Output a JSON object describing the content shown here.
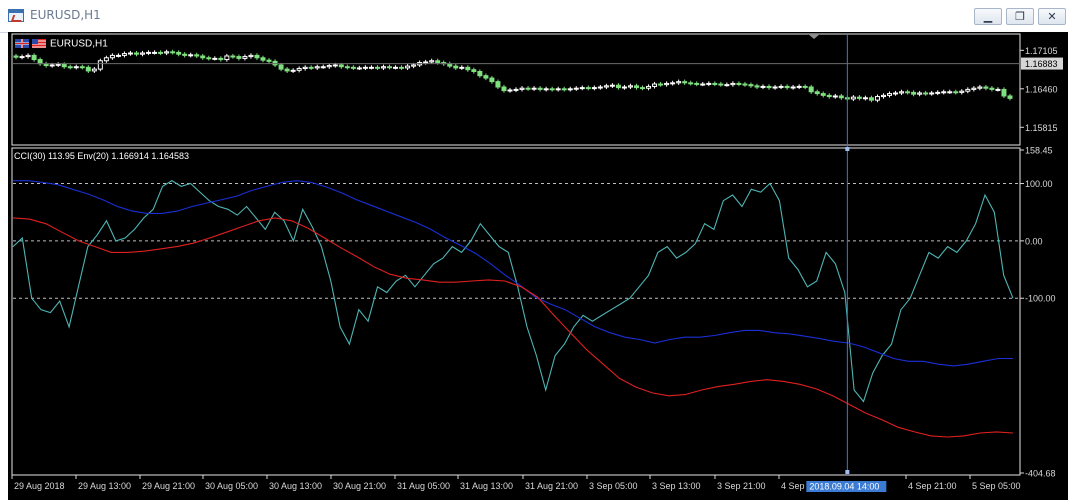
{
  "window": {
    "title": "EURUSD,H1",
    "minimize_label": "▁",
    "restore_label": "❐",
    "close_label": "✕"
  },
  "colors": {
    "background": "#000000",
    "candle_up": "#ffffff",
    "candle_down": "#7fe07f",
    "cci_line": "#4fb4b4",
    "env_upper": "#1a2fd6",
    "env_lower": "#e02020",
    "crosshair": "#3b7bd4",
    "axis_text": "#d8d8d8"
  },
  "chart_data": [
    {
      "type": "candlestick",
      "title": "EURUSD,H1",
      "symbol_flags": [
        "GB-flag-icon",
        "US-flag-icon"
      ],
      "ylim": [
        1.15535,
        1.17345
      ],
      "y_ticks": [
        "1.17105",
        "1.16460",
        "1.15815"
      ],
      "current_price_label": "1.16883",
      "current_price": 1.16883,
      "crosshair_x_index": 138,
      "close": [
        1.1699,
        1.17,
        1.1702,
        1.1695,
        1.1688,
        1.1685,
        1.1686,
        1.1687,
        1.1683,
        1.1682,
        1.1683,
        1.1682,
        1.1676,
        1.1679,
        1.1693,
        1.1698,
        1.1702,
        1.1702,
        1.1705,
        1.1706,
        1.1704,
        1.1706,
        1.1707,
        1.1707,
        1.1706,
        1.1708,
        1.1707,
        1.1704,
        1.1702,
        1.1703,
        1.1701,
        1.1698,
        1.1697,
        1.1697,
        1.1695,
        1.1701,
        1.17,
        1.1697,
        1.17,
        1.1702,
        1.1698,
        1.1694,
        1.1692,
        1.1686,
        1.1679,
        1.1676,
        1.1677,
        1.168,
        1.1682,
        1.1681,
        1.1683,
        1.1683,
        1.1685,
        1.1686,
        1.1683,
        1.1682,
        1.1681,
        1.1681,
        1.1682,
        1.1682,
        1.1681,
        1.1683,
        1.1682,
        1.1682,
        1.1681,
        1.1684,
        1.1686,
        1.169,
        1.1691,
        1.1693,
        1.169,
        1.1688,
        1.1684,
        1.1681,
        1.1682,
        1.1678,
        1.1675,
        1.1668,
        1.1664,
        1.1658,
        1.1649,
        1.1643,
        1.1644,
        1.1645,
        1.1647,
        1.1646,
        1.1647,
        1.1645,
        1.1646,
        1.1645,
        1.1646,
        1.1645,
        1.1646,
        1.1647,
        1.1648,
        1.1647,
        1.1648,
        1.1649,
        1.1651,
        1.1652,
        1.1648,
        1.1649,
        1.1651,
        1.1648,
        1.1647,
        1.165,
        1.1654,
        1.1653,
        1.1655,
        1.1656,
        1.1658,
        1.1656,
        1.1655,
        1.1654,
        1.1654,
        1.1655,
        1.1654,
        1.1653,
        1.1653,
        1.1655,
        1.1654,
        1.1653,
        1.1651,
        1.1649,
        1.165,
        1.1648,
        1.1649,
        1.165,
        1.1648,
        1.1649,
        1.165,
        1.1649,
        1.1641,
        1.1638,
        1.1635,
        1.1633,
        1.1634,
        1.1631,
        1.1629,
        1.1632,
        1.163,
        1.1631,
        1.1627,
        1.1633,
        1.1635,
        1.1638,
        1.1639,
        1.1641,
        1.164,
        1.1637,
        1.1639,
        1.1638,
        1.1639,
        1.164,
        1.1641,
        1.1641,
        1.164,
        1.1642,
        1.1645,
        1.1647,
        1.1649,
        1.1647,
        1.1645,
        1.1645,
        1.1634,
        1.163
      ]
    },
    {
      "type": "line",
      "title": "CCI(30) 113.95 Env(20) 1.166914 1.164583",
      "ylim": [
        -404.68,
        158.45
      ],
      "y_ticks": [
        "158.45",
        "100.00",
        "0.00",
        "-100.00",
        "-404.68"
      ],
      "levels": [
        100,
        0,
        -100
      ],
      "x_tick_labels": [
        "29 Aug 2018",
        "29 Aug 13:00",
        "29 Aug 21:00",
        "30 Aug 05:00",
        "30 Aug 13:00",
        "30 Aug 21:00",
        "31 Aug 05:00",
        "31 Aug 13:00",
        "31 Aug 21:00",
        "3 Sep 05:00",
        "3 Sep 13:00",
        "3 Sep 21:00",
        "4 Sep 0",
        "4 Sep 21:00",
        "5 Sep 05:00"
      ],
      "crosshair_time_label": "2018.09.04 14:00",
      "series": [
        {
          "values": [
            -10,
            5,
            -100,
            -120,
            -125,
            -105,
            -150,
            -80,
            -10,
            10,
            35,
            0,
            5,
            20,
            40,
            55,
            95,
            105,
            95,
            100,
            85,
            70,
            60,
            55,
            45,
            60,
            40,
            20,
            50,
            35,
            0,
            55,
            25,
            -10,
            -70,
            -150,
            -180,
            -120,
            -140,
            -80,
            -90,
            -70,
            -60,
            -80,
            -60,
            -40,
            -30,
            -10,
            -20,
            0,
            30,
            10,
            -10,
            -20,
            -80,
            -150,
            -200,
            -260,
            -200,
            -180,
            -150,
            -130,
            -140,
            -130,
            -120,
            -110,
            -100,
            -80,
            -60,
            -20,
            -10,
            -30,
            -20,
            -5,
            30,
            20,
            70,
            80,
            60,
            90,
            85,
            100,
            70,
            -30,
            -50,
            -80,
            -70,
            -20,
            -40,
            -90,
            -260,
            -280,
            -230,
            -200,
            -180,
            -120,
            -100,
            -60,
            -20,
            -30,
            -10,
            -20,
            0,
            30,
            80,
            50,
            -60,
            -100
          ],
          "color": "#4fb4b4"
        },
        {
          "values": [
            105,
            105,
            102,
            98,
            90,
            82,
            72,
            60,
            52,
            48,
            48,
            52,
            60,
            66,
            72,
            78,
            88,
            95,
            102,
            105,
            102,
            94,
            84,
            72,
            62,
            52,
            42,
            32,
            20,
            5,
            -8,
            -22,
            -40,
            -60,
            -78,
            -98,
            -110,
            -120,
            -135,
            -150,
            -160,
            -168,
            -172,
            -178,
            -172,
            -168,
            -168,
            -165,
            -160,
            -156,
            -156,
            -160,
            -162,
            -166,
            -170,
            -175,
            -178,
            -185,
            -195,
            -205,
            -210,
            -210,
            -215,
            -218,
            -215,
            -210,
            -205,
            -205
          ],
          "color": "#1a2fd6"
        },
        {
          "values": [
            40,
            38,
            30,
            15,
            0,
            -10,
            -20,
            -20,
            -18,
            -14,
            -10,
            -4,
            5,
            15,
            25,
            35,
            40,
            35,
            22,
            5,
            -12,
            -28,
            -45,
            -58,
            -65,
            -68,
            -72,
            -72,
            -70,
            -68,
            -70,
            -80,
            -98,
            -130,
            -160,
            -190,
            -215,
            -240,
            -255,
            -265,
            -270,
            -268,
            -260,
            -254,
            -250,
            -245,
            -242,
            -245,
            -250,
            -258,
            -270,
            -285,
            -300,
            -312,
            -325,
            -333,
            -340,
            -342,
            -340,
            -335,
            -333,
            -335
          ],
          "color": "#e02020"
        }
      ]
    }
  ]
}
